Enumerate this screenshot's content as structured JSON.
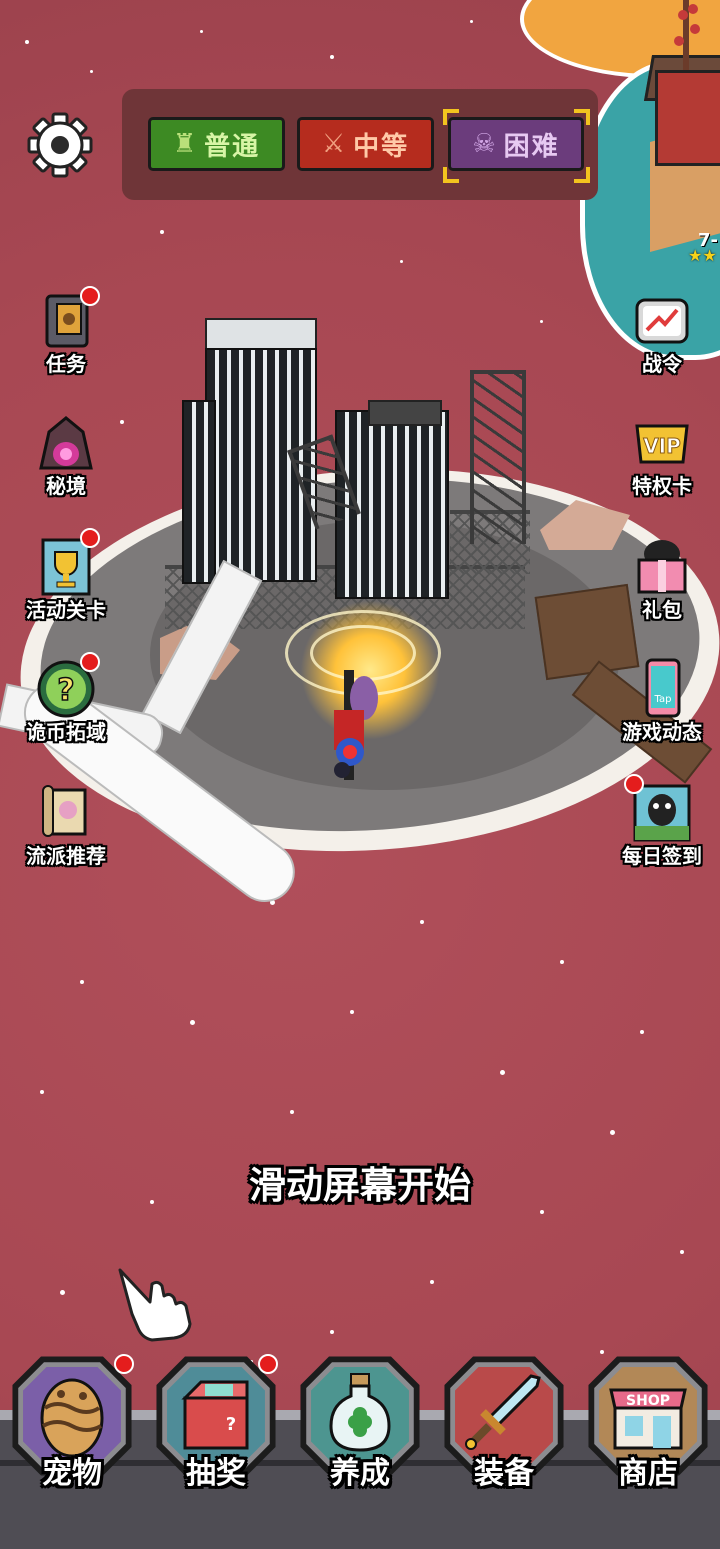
{
  "difficulty": {
    "normal": {
      "label": "普通",
      "icon": "tower-icon"
    },
    "medium": {
      "label": "中等",
      "icon": "crossed-swords-icon"
    },
    "hard": {
      "label": "困难",
      "icon": "skull-icon",
      "selected": true
    }
  },
  "settings": {
    "icon": "gear-icon"
  },
  "level_badge": {
    "text": "7-",
    "stars": "★★"
  },
  "left_menu": [
    {
      "label": "任务",
      "icon": "book-icon",
      "badge": true
    },
    {
      "label": "秘境",
      "icon": "cave-portal-icon",
      "badge": false
    },
    {
      "label": "活动关卡",
      "icon": "trophy-card-icon",
      "badge": true
    },
    {
      "label": "诡币拓域",
      "icon": "question-coin-icon",
      "badge": true
    },
    {
      "label": "流派推荐",
      "icon": "scroll-icon",
      "badge": false
    }
  ],
  "right_menu": [
    {
      "label": "战令",
      "icon": "tv-chart-icon",
      "badge": false
    },
    {
      "label": "特权卡",
      "icon": "vip-icon",
      "badge": false
    },
    {
      "label": "礼包",
      "icon": "gift-box-icon",
      "badge": false
    },
    {
      "label": "游戏动态",
      "icon": "tap-phone-icon",
      "badge": false
    },
    {
      "label": "每日签到",
      "icon": "calendar-monster-icon",
      "badge": true
    }
  ],
  "prompt": "滑动屏幕开始",
  "bottom_nav": [
    {
      "label": "宠物",
      "icon": "egg-icon",
      "badge": true,
      "bg": "#7b5fa8"
    },
    {
      "label": "抽奖",
      "icon": "mystery-box-icon",
      "badge": true,
      "bg": "#4f8c98"
    },
    {
      "label": "养成",
      "icon": "clover-bottle-icon",
      "badge": false,
      "bg": "#4d9590"
    },
    {
      "label": "装备",
      "icon": "sword-icon",
      "badge": false,
      "bg": "#b94a4a"
    },
    {
      "label": "商店",
      "icon": "shop-icon",
      "badge": false,
      "bg": "#b28857"
    }
  ],
  "colors": {
    "sea": "#a94a55",
    "accent_selected": "#f3c41f",
    "badge": "#e41d1d"
  }
}
